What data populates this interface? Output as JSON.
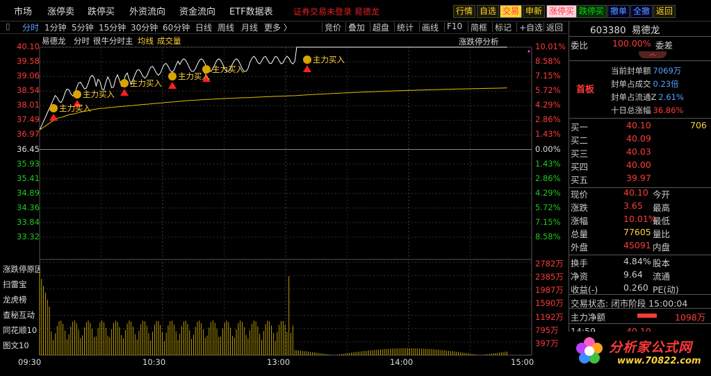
{
  "menu": {
    "items": [
      "市场",
      "涨停卖",
      "跌停买",
      "外资流向",
      "资金流向",
      "ETF数据表"
    ],
    "notice": "证券交易未登录  易德龙",
    "buttons": [
      {
        "label": "行情",
        "color": "#ffd23a",
        "bg": "#1a1a00"
      },
      {
        "label": "自选",
        "color": "#ffd23a",
        "bg": "#1a1a00"
      },
      {
        "label": "交易",
        "color": "#ff3a3a",
        "bg": "#ffd23a"
      },
      {
        "label": "申新",
        "color": "#ffd23a",
        "bg": "#1a1a00"
      },
      {
        "label": "涨停买",
        "color": "#ff3a3a",
        "bg": "#ffd0e0"
      },
      {
        "label": "跌停买",
        "color": "#1ec81e",
        "bg": "#003300"
      },
      {
        "label": "撤单",
        "color": "#5aa0ff",
        "bg": "#00002a"
      },
      {
        "label": "全撤",
        "color": "#5aa0ff",
        "bg": "#00002a"
      },
      {
        "label": "返回",
        "color": "#ffd23a",
        "bg": "#1a1a00"
      }
    ]
  },
  "toolbar": {
    "tabs": [
      "分时",
      "1分钟",
      "5分钟",
      "15分钟",
      "30分钟",
      "60分钟",
      "日线",
      "周线",
      "月线",
      "更多 〉"
    ],
    "tools": [
      "竞价",
      "叠加",
      "超盘",
      "统计",
      "画线",
      "F10",
      "简框",
      "标记",
      "+自选",
      "返回"
    ]
  },
  "chart": {
    "stock_name": "易德龙",
    "legend": [
      "分时",
      "很牛分时主",
      "均线",
      "成交量"
    ],
    "panel_label": "涨跌停分析",
    "left_prices": [
      "40.10",
      "39.58",
      "39.06",
      "38.54",
      "38.01",
      "37.49",
      "36.97",
      "36.45",
      "35.93",
      "35.41",
      "34.89",
      "34.36",
      "33.84",
      "33.32"
    ],
    "right_pcts": [
      "10.01%",
      "8.58%",
      "7.15%",
      "5.72%",
      "4.29%",
      "2.86%",
      "1.43%",
      "0.00%",
      "1.43%",
      "2.86%",
      "4.29%",
      "5.72%",
      "7.15%",
      "8.58%"
    ],
    "vol_labels": [
      "2782万",
      "2385万",
      "1987万",
      "1590万",
      "1192万",
      "795万",
      "397万"
    ],
    "side_tabs": [
      "涨跌停原因",
      "扫雷宝",
      "龙虎榜",
      "查秘互动",
      "同花顺10",
      "图文10"
    ],
    "time_labels": [
      "09:30",
      "10:30",
      "13:00",
      "14:00",
      "15:00"
    ],
    "signal_text": "主力买入",
    "colors": {
      "price_up": "#ff3a3a",
      "price_down": "#1ec81e",
      "line": "#ffffff",
      "avg": "#e6c200",
      "vol": "#e6c200"
    }
  },
  "quote": {
    "code": "603380",
    "name": "易德龙",
    "weibi_label": "委比",
    "weibi_value": "100.00%",
    "weicha_label": "委差",
    "status_tag": "首板",
    "stats": [
      {
        "label": "当前封单额",
        "value": "7069万"
      },
      {
        "label": "封单占成交",
        "value": "0.23倍"
      },
      {
        "label": "封单占流通Z",
        "value": "2.61%"
      },
      {
        "label": "十日总涨幅",
        "value": "36.86%"
      }
    ],
    "bids": [
      {
        "label": "买一",
        "price": "40.10",
        "vol": "706"
      },
      {
        "label": "买二",
        "price": "40.09",
        "vol": ""
      },
      {
        "label": "买三",
        "price": "40.03",
        "vol": ""
      },
      {
        "label": "买四",
        "price": "40.00",
        "vol": ""
      },
      {
        "label": "买五",
        "price": "39.97",
        "vol": ""
      }
    ],
    "info": [
      {
        "l1": "现价",
        "v1": "40.10",
        "l2": "今开",
        "c1": "#ff3a3a"
      },
      {
        "l1": "涨跌",
        "v1": "3.65",
        "l2": "最高",
        "c1": "#ff3a3a"
      },
      {
        "l1": "涨幅",
        "v1": "10.01%",
        "l2": "最低",
        "c1": "#ff3a3a"
      },
      {
        "l1": "总量",
        "v1": "77605",
        "l2": "量比",
        "c1": "#ffd23a"
      },
      {
        "l1": "外盘",
        "v1": "45091",
        "l2": "内盘",
        "c1": "#ff3a3a"
      }
    ],
    "info2": [
      {
        "l1": "换手",
        "v1": "4.84%",
        "l2": "股本"
      },
      {
        "l1": "净资",
        "v1": "9.64",
        "l2": "流通"
      },
      {
        "l1": "收益(-)",
        "v1": "0.260",
        "l2": "PE(动)"
      }
    ],
    "trade_status_label": "交易状态:",
    "trade_status_value": "闭市阶段 15:00:04",
    "net_label": "主力净额",
    "net_value": "1098万",
    "tick_time": "14:59",
    "tick_price": "40.10"
  },
  "watermark": {
    "title": "分析家公式网",
    "url": "www.70822.com"
  }
}
